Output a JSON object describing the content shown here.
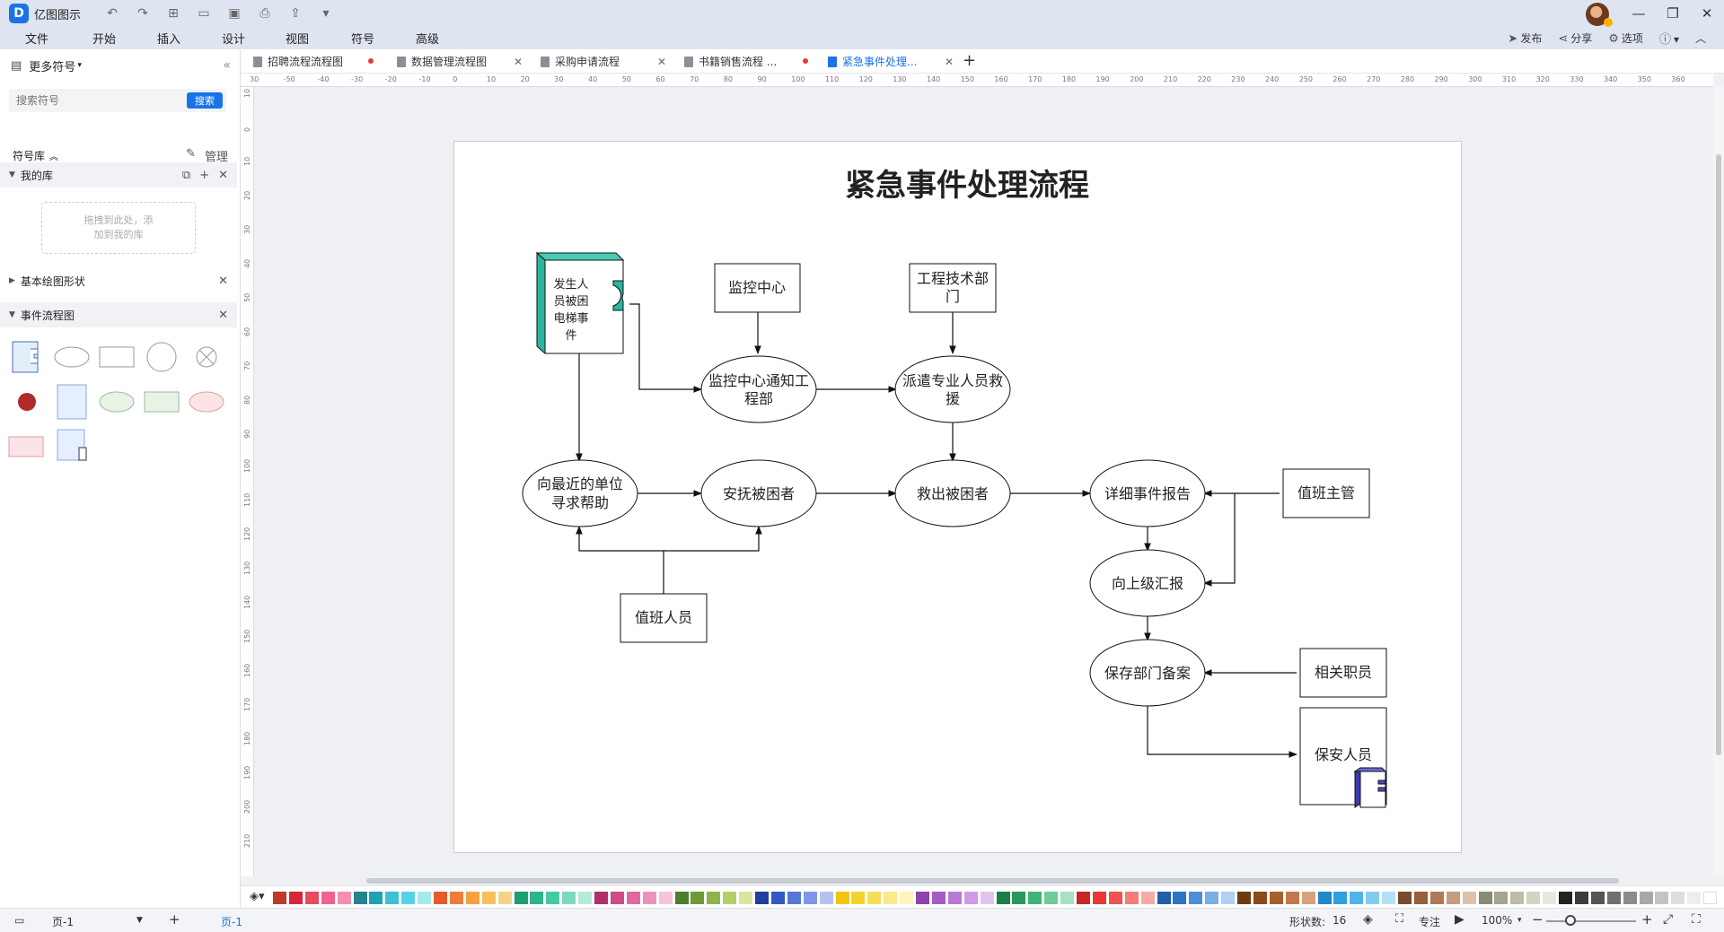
{
  "app": {
    "name": "亿图图示"
  },
  "menu": [
    "文件",
    "开始",
    "插入",
    "设计",
    "视图",
    "符号",
    "高级"
  ],
  "menu_right": {
    "publish": "发布",
    "share": "分享",
    "options": "选项",
    "help": "?"
  },
  "sidebar": {
    "title": "更多符号",
    "search_placeholder": "搜索符号",
    "search_button": "搜索",
    "library_label": "符号库",
    "manage": "管理",
    "my_library": "我的库",
    "drop_hint_line1": "拖拽到此处，添",
    "drop_hint_line2": "加到我的库",
    "basic_shapes": "基本绘图形状",
    "event_flowchart": "事件流程图"
  },
  "tabs": [
    {
      "label": "招聘流程流程图",
      "modified": true
    },
    {
      "label": "数据管理流程图",
      "modified": false
    },
    {
      "label": "采购申请流程",
      "modified": false
    },
    {
      "label": "书籍销售流程 ...",
      "modified": true
    },
    {
      "label": "紧急事件处理...",
      "modified": false,
      "active": true
    }
  ],
  "ruler_h": [
    "30",
    "-50",
    "-40",
    "-30",
    "-20",
    "-10",
    "0",
    "10",
    "20",
    "30",
    "40",
    "50",
    "60",
    "70",
    "80",
    "90",
    "100",
    "110",
    "120",
    "130",
    "140",
    "150",
    "160",
    "170",
    "180",
    "190",
    "200",
    "210",
    "220",
    "230",
    "240",
    "250",
    "260",
    "270",
    "280",
    "290",
    "300",
    "310",
    "320",
    "330",
    "340",
    "350",
    "360"
  ],
  "ruler_v": [
    "10",
    "0",
    "10",
    "20",
    "30",
    "40",
    "50",
    "60",
    "70",
    "80",
    "90",
    "100",
    "110",
    "120",
    "130",
    "140",
    "150",
    "160",
    "170",
    "180",
    "190",
    "200",
    "210"
  ],
  "diagram": {
    "title": "紧急事件处理流程",
    "nodes": {
      "trapped_line1": "发生人",
      "trapped_line2": "员被困",
      "trapped_line3": "电梯事",
      "trapped_line4": "件",
      "monitor_center": "监控中心",
      "eng_dept_line1": "工程技术部",
      "eng_dept_line2": "门",
      "notify_line1": "监控中心通知工",
      "notify_line2": "程部",
      "dispatch_line1": "派遣专业人员救",
      "dispatch_line2": "援",
      "seek_help_line1": "向最近的单位",
      "seek_help_line2": "寻求帮助",
      "comfort": "安抚被困者",
      "rescue": "救出被困者",
      "report": "详细事件报告",
      "supervisor": "值班主管",
      "escalate": "向上级汇报",
      "duty_staff": "值班人员",
      "archive": "保存部门备案",
      "related_staff": "相关职员",
      "security": "保安人员"
    }
  },
  "status": {
    "page_selector": "页-1",
    "page_tab": "页-1",
    "shape_count_label": "形状数:",
    "shape_count": "16",
    "focus": "专注",
    "zoom": "100%"
  },
  "palette": [
    "#c0392b",
    "#d62839",
    "#e84a5f",
    "#f06292",
    "#f48fb1",
    "#26828e",
    "#1fa2b4",
    "#3ec1d3",
    "#57d3e6",
    "#a6e8f0",
    "#e85a2c",
    "#f07c3c",
    "#f5a041",
    "#f8bf5c",
    "#f5d28b",
    "#1e9e74",
    "#2bb58a",
    "#46c9a0",
    "#7dd9bb",
    "#b5ead7",
    "#b0306c",
    "#d04b86",
    "#e06aa0",
    "#ec93bd",
    "#f6c3dc",
    "#4e7d2d",
    "#6c9a3a",
    "#8db54a",
    "#b3cf6a",
    "#d8e6a0",
    "#1f3fa3",
    "#3457c4",
    "#5875d8",
    "#8296e6",
    "#b5c2f1",
    "#f1c40f",
    "#f5d12e",
    "#f8de58",
    "#fbe98a",
    "#fdf3bd",
    "#8e44ad",
    "#a35cc4",
    "#b97ad6",
    "#cd9ce4",
    "#e2c3f0",
    "#1a7f4b",
    "#27995e",
    "#3fb476",
    "#6fcb98",
    "#a7e2c1",
    "#c62828",
    "#e53935",
    "#ef5350",
    "#f47c7a",
    "#f8aaa8",
    "#1f5fa6",
    "#2c75c4",
    "#4a8fd8",
    "#7aaee6",
    "#b0cff2",
    "#6d3b12",
    "#8b4a16",
    "#a8602a",
    "#c27a4a",
    "#d9a07e",
    "#1e88c8",
    "#2fa0de",
    "#51b5ea",
    "#80cbf2",
    "#b4e0f8",
    "#7a4a2e",
    "#94603d",
    "#ae7b58",
    "#c79b7c",
    "#dfc1ab",
    "#8a8a78",
    "#a5a58f",
    "#bdbda8",
    "#d3d3c2",
    "#e8e8dc",
    "#222222",
    "#3c3c3c",
    "#555555",
    "#707070",
    "#8c8c8c",
    "#a8a8a8",
    "#c4c4c4",
    "#dddddd",
    "#eeeeee",
    "#ffffff"
  ]
}
